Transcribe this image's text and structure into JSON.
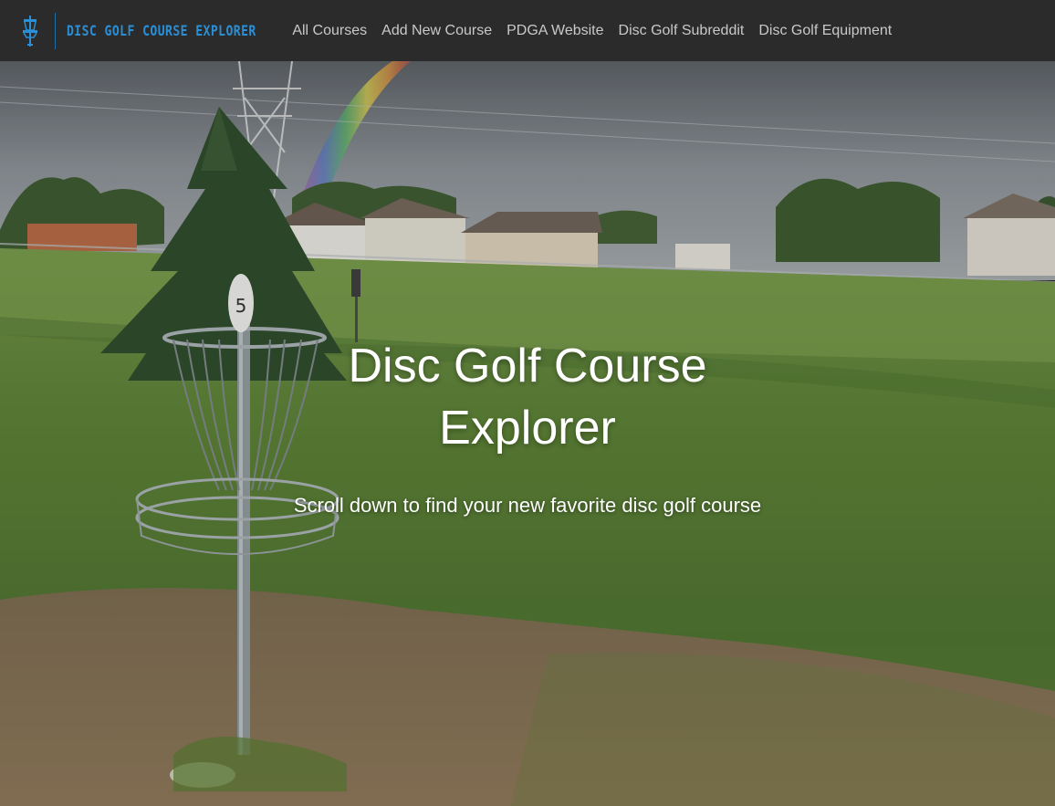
{
  "navbar": {
    "brand": {
      "icon": "disc-golf-basket-icon",
      "text": "Disc Golf Course Explorer",
      "color": "#2a8fd6"
    },
    "links": [
      {
        "label": "All Courses"
      },
      {
        "label": "Add New Course"
      },
      {
        "label": "PDGA Website"
      },
      {
        "label": "Disc Golf Subreddit"
      },
      {
        "label": "Disc Golf Equipment"
      }
    ],
    "background": "#2b2b2b"
  },
  "hero": {
    "title": "Disc Golf Course Explorer",
    "subtitle": "Scroll down to find your new favorite disc golf course",
    "image": {
      "description_icon": "disc-golf-basket-photo",
      "hole_number": "5"
    }
  }
}
